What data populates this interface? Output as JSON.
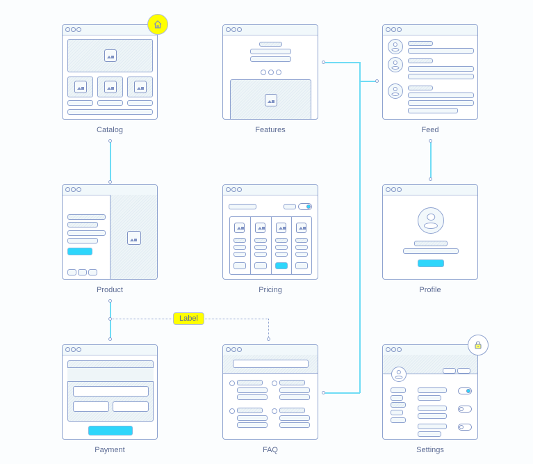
{
  "screens": [
    {
      "id": "catalog",
      "label": "Catalog",
      "badge": "home-icon"
    },
    {
      "id": "features",
      "label": "Features"
    },
    {
      "id": "feed",
      "label": "Feed"
    },
    {
      "id": "product",
      "label": "Product"
    },
    {
      "id": "pricing",
      "label": "Pricing"
    },
    {
      "id": "profile",
      "label": "Profile"
    },
    {
      "id": "payment",
      "label": "Payment"
    },
    {
      "id": "faq",
      "label": "FAQ"
    },
    {
      "id": "settings",
      "label": "Settings",
      "badge": "lock-icon"
    }
  ],
  "connections": [
    {
      "from": "Catalog",
      "to": "Product",
      "style": "solid"
    },
    {
      "from": "Feed",
      "to": "Profile",
      "style": "solid"
    },
    {
      "from": "Features",
      "to": "Feed",
      "style": "solid"
    },
    {
      "from": "FAQ",
      "to": "Feed",
      "style": "solid"
    },
    {
      "from": "Product",
      "to": "FAQ",
      "style": "dotted",
      "label": "Label"
    }
  ],
  "connector_label": "Label",
  "colors": {
    "accent": "#2ed6fb",
    "badge": "#ffff00",
    "stroke": "#8fa3cf",
    "connector": "#6fdcf5",
    "text": "#5d6c94"
  }
}
